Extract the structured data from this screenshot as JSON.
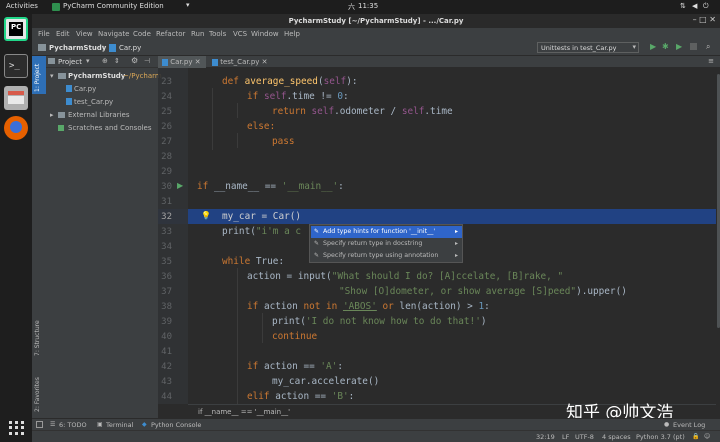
{
  "topbar": {
    "activities": "Activities",
    "app": "PyCharm Community Edition",
    "day": "六",
    "time": "11:35"
  },
  "window": {
    "title": "PycharmStudy [~/PycharmStudy] - .../Car.py"
  },
  "menu": [
    "File",
    "Edit",
    "View",
    "Navigate",
    "Code",
    "Refactor",
    "Run",
    "Tools",
    "VCS",
    "Window",
    "Help"
  ],
  "nav": {
    "project": "PycharmStudy",
    "file": "Car.py",
    "run_config": "Unittests in test_Car.py"
  },
  "side": {
    "project_tab": "1: Project",
    "structure_tab": "7: Structure",
    "favorites_tab": "2: Favorites"
  },
  "project_panel": {
    "title": "Project",
    "root": "PycharmStudy",
    "root_path": "~/Pycharm",
    "files": [
      "Car.py",
      "test_Car.py"
    ],
    "external": "External Libraries",
    "scratches": "Scratches and Consoles"
  },
  "tabs": [
    "Car.py",
    "test_Car.py"
  ],
  "lines": [
    "23",
    "24",
    "25",
    "26",
    "27",
    "28",
    "29",
    "30",
    "31",
    "32",
    "33",
    "34",
    "35",
    "36",
    "37",
    "38",
    "39",
    "40",
    "41",
    "42",
    "43",
    "44"
  ],
  "code": {
    "l23_a": "def ",
    "l23_b": "average_speed",
    "l23_c": "(",
    "l23_d": "self",
    "l23_e": "):",
    "l24_a": "if ",
    "l24_b": "self",
    "l24_c": ".time != ",
    "l24_d": "0",
    "l24_e": ":",
    "l25_a": "return ",
    "l25_b": "self",
    "l25_c": ".odometer / ",
    "l25_d": "self",
    "l25_e": ".time",
    "l26": "else:",
    "l27": "pass",
    "l30_a": "if ",
    "l30_b": "__name__ == ",
    "l30_c": "'__main__'",
    "l30_d": ":",
    "l32": "my_car = Car()",
    "l33_a": "print(",
    "l33_b": "\"i'm a c",
    "l35_a": "while ",
    "l35_b": "True:",
    "l36_a": "action = ",
    "l36_b": "input(",
    "l36_c": "\"What should I do? [A]ccelate, [B]rake, \"",
    "l37_a": "\"Show [O]dometer, or show average [S]peed\"",
    "l37_b": ").upper()",
    "l38_a": "if ",
    "l38_b": "action ",
    "l38_c": "not in ",
    "l38_d": "'ABOS'",
    "l38_e": " or ",
    "l38_f": "len(action) > ",
    "l38_g": "1",
    "l38_h": ":",
    "l39_a": "print(",
    "l39_b": "'I do not know how to do that!'",
    "l39_c": ")",
    "l40": "continue",
    "l42_a": "if ",
    "l42_b": "action == ",
    "l42_c": "'A'",
    "l42_d": ":",
    "l43": "my_car.accelerate()",
    "l44_a": "elif ",
    "l44_b": "action == ",
    "l44_c": "'B'",
    "l44_d": ":"
  },
  "popup": [
    "Add type hints for function '__init__'",
    "Specify return type in docstring",
    "Specify return type using annotation"
  ],
  "breadcrumb": "if __name__ == '__main__'",
  "bottom": {
    "todo": "6: TODO",
    "terminal": "Terminal",
    "console": "Python Console",
    "event_log": "Event Log"
  },
  "status": {
    "position": "32:19",
    "line_sep": "LF",
    "encoding": "UTF-8",
    "indent": "4 spaces",
    "interpreter": "Python 3.7 (pt)"
  },
  "watermark": "知乎 @帅文浩"
}
